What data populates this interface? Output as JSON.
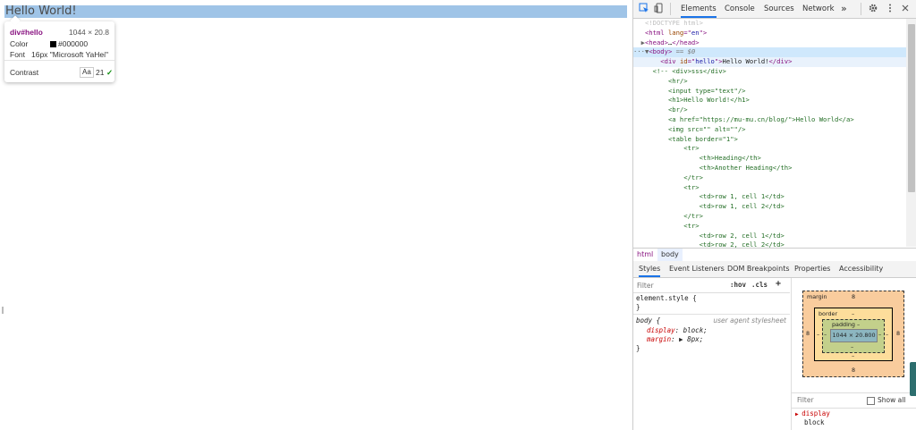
{
  "page": {
    "hello_text": "Hello World!",
    "highlight_color": "#9fc4e7"
  },
  "tooltip": {
    "selector": "div#hello",
    "size": "1044 × 20.8",
    "color_label": "Color",
    "color_value": "#000000",
    "font_label": "Font",
    "font_value": "16px \"Microsoft YaHei\"",
    "contrast_label": "Contrast",
    "contrast_aa": "Aa",
    "contrast_ratio": "21",
    "contrast_check": "✓"
  },
  "devtools": {
    "tabs": [
      {
        "label": "Elements",
        "active": true
      },
      {
        "label": "Console",
        "active": false
      },
      {
        "label": "Sources",
        "active": false
      },
      {
        "label": "Network",
        "active": false
      }
    ],
    "more_tabs": "»",
    "icons": [
      "inspect-icon",
      "device-toolbar-icon",
      "settings-gear-icon",
      "more-vertical-icon",
      "close-icon"
    ],
    "dom_lines": [
      {
        "indent": "",
        "parts": [
          {
            "c": "t-doctype",
            "t": "<!DOCTYPE html>"
          }
        ]
      },
      {
        "indent": "",
        "parts": [
          {
            "c": "t-tag",
            "t": "<html "
          },
          {
            "c": "t-attr",
            "t": "lang"
          },
          {
            "c": "t-tag",
            "t": "=\""
          },
          {
            "c": "t-val",
            "t": "en"
          },
          {
            "c": "t-tag",
            "t": "\">"
          }
        ]
      },
      {
        "indent": "",
        "toggle": "▶",
        "parts": [
          {
            "c": "t-tag",
            "t": "<head>"
          },
          {
            "c": "t-text",
            "t": "…"
          },
          {
            "c": "t-tag",
            "t": "</head>"
          }
        ]
      },
      {
        "indent": "",
        "toggle": "▼",
        "sel": true,
        "parts": [
          {
            "c": "t-tag",
            "t": "<body>"
          },
          {
            "c": "t-eq",
            "t": " == $0"
          }
        ]
      },
      {
        "indent": "    ",
        "hover": true,
        "parts": [
          {
            "c": "t-tag",
            "t": "<div "
          },
          {
            "c": "t-attr",
            "t": "id"
          },
          {
            "c": "t-tag",
            "t": "=\""
          },
          {
            "c": "t-val",
            "t": "hello"
          },
          {
            "c": "t-tag",
            "t": "\">"
          },
          {
            "c": "t-text",
            "t": "Hello World!"
          },
          {
            "c": "t-tag",
            "t": "</div>"
          }
        ]
      },
      {
        "indent": "  ",
        "parts": [
          {
            "c": "t-cmt",
            "t": "<!-- <div>sss</div>"
          }
        ]
      },
      {
        "indent": "      ",
        "parts": [
          {
            "c": "t-cmt",
            "t": "<hr/>"
          }
        ]
      },
      {
        "indent": "      ",
        "parts": [
          {
            "c": "t-cmt",
            "t": "<input type=\"text\"/>"
          }
        ]
      },
      {
        "indent": "      ",
        "parts": [
          {
            "c": "t-cmt",
            "t": "<h1>Hello World!</h1>"
          }
        ]
      },
      {
        "indent": "      ",
        "parts": [
          {
            "c": "t-cmt",
            "t": "<br/>"
          }
        ]
      },
      {
        "indent": "      ",
        "parts": [
          {
            "c": "t-cmt",
            "t": "<a href=\"https://mu-mu.cn/blog/\">Hello World</a>"
          }
        ]
      },
      {
        "indent": "      ",
        "parts": [
          {
            "c": "t-cmt",
            "t": "<img src=\"\" alt=\"\"/>"
          }
        ]
      },
      {
        "indent": "      ",
        "parts": [
          {
            "c": "t-cmt",
            "t": "<table border=\"1\">"
          }
        ]
      },
      {
        "indent": "          ",
        "parts": [
          {
            "c": "t-cmt",
            "t": "<tr>"
          }
        ]
      },
      {
        "indent": "              ",
        "parts": [
          {
            "c": "t-cmt",
            "t": "<th>Heading</th>"
          }
        ]
      },
      {
        "indent": "              ",
        "parts": [
          {
            "c": "t-cmt",
            "t": "<th>Another Heading</th>"
          }
        ]
      },
      {
        "indent": "          ",
        "parts": [
          {
            "c": "t-cmt",
            "t": "</tr>"
          }
        ]
      },
      {
        "indent": "          ",
        "parts": [
          {
            "c": "t-cmt",
            "t": "<tr>"
          }
        ]
      },
      {
        "indent": "              ",
        "parts": [
          {
            "c": "t-cmt",
            "t": "<td>row 1, cell 1</td>"
          }
        ]
      },
      {
        "indent": "              ",
        "parts": [
          {
            "c": "t-cmt",
            "t": "<td>row 1, cell 2</td>"
          }
        ]
      },
      {
        "indent": "          ",
        "parts": [
          {
            "c": "t-cmt",
            "t": "</tr>"
          }
        ]
      },
      {
        "indent": "          ",
        "parts": [
          {
            "c": "t-cmt",
            "t": "<tr>"
          }
        ]
      },
      {
        "indent": "              ",
        "parts": [
          {
            "c": "t-cmt",
            "t": "<td>row 2, cell 1</td>"
          }
        ]
      },
      {
        "indent": "              ",
        "parts": [
          {
            "c": "t-cmt",
            "t": "<td>row 2, cell 2</td>"
          }
        ]
      }
    ],
    "breadcrumbs": [
      "html",
      "body"
    ],
    "sub_tabs": [
      {
        "label": "Styles",
        "active": true
      },
      {
        "label": "Event Listeners",
        "active": false
      },
      {
        "label": "DOM Breakpoints",
        "active": false
      },
      {
        "label": "Properties",
        "active": false
      },
      {
        "label": "Accessibility",
        "active": false
      }
    ],
    "styles": {
      "filter_placeholder": "Filter",
      "hov": ":hov",
      "cls": ".cls",
      "add": "+",
      "element_style_open": "element.style {",
      "element_style_close": "}",
      "body_selector": "body {",
      "body_origin": "user agent stylesheet",
      "body_prop1_name": "display",
      "body_prop1_value": ": block;",
      "body_prop2_name": "margin",
      "body_prop2_value": ": ▶ 8px;",
      "body_close": "}"
    },
    "box_model": {
      "margin_label": "margin",
      "margin_top": "8",
      "margin_right": "8",
      "margin_bottom": "8",
      "margin_left": "8",
      "border_label": "border",
      "border_top": "–",
      "border_right": "–",
      "border_bottom": "–",
      "border_left": "–",
      "padding_label": "padding –",
      "padding_right": "–",
      "padding_bottom": "–",
      "padding_left": "–",
      "content": "1044 × 20.800"
    },
    "computed": {
      "filter_placeholder": "Filter",
      "show_all": "Show all",
      "prop_name": "display",
      "prop_value": "block"
    }
  }
}
